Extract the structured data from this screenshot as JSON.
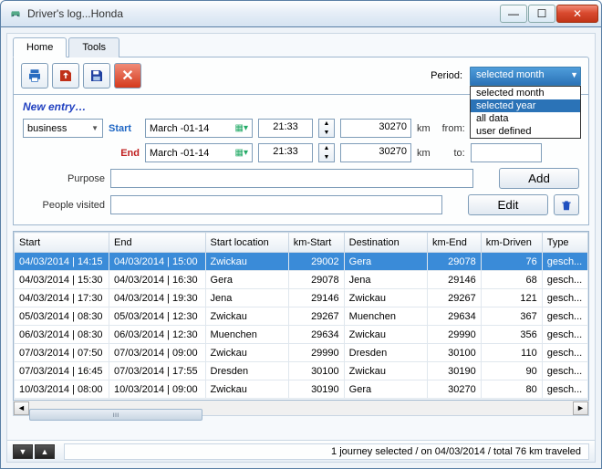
{
  "window": {
    "title": "Driver's log...Honda"
  },
  "tabs": {
    "home": "Home",
    "tools": "Tools"
  },
  "toolbar": {
    "period_label": "Period:",
    "period_selected": "selected month",
    "period_options": [
      "selected month",
      "selected year",
      "all data",
      "user defined"
    ],
    "period_highlight_index": 1
  },
  "newentry": {
    "heading": "New entry…",
    "type_value": "business",
    "start_label": "Start",
    "end_label": "End",
    "start_date": "March  -01-14",
    "end_date": "March  -01-14",
    "start_time": "21:33",
    "end_time": "21:33",
    "start_km": "30270",
    "end_km": "30270",
    "km_unit": "km",
    "from_label": "from:",
    "to_label": "to:",
    "purpose_label": "Purpose",
    "people_label": "People visited",
    "add_btn": "Add",
    "edit_btn": "Edit"
  },
  "grid": {
    "headers": [
      "Start",
      "End",
      "Start location",
      "km-Start",
      "Destination",
      "km-End",
      "km-Driven",
      "Type"
    ],
    "rows": [
      {
        "start": "04/03/2014 | 14:15",
        "end": "04/03/2014 | 15:00",
        "sloc": "Zwickau",
        "skm": "29002",
        "dest": "Gera",
        "ekm": "29078",
        "drv": "76",
        "type": "gesch..."
      },
      {
        "start": "04/03/2014 | 15:30",
        "end": "04/03/2014 | 16:30",
        "sloc": "Gera",
        "skm": "29078",
        "dest": "Jena",
        "ekm": "29146",
        "drv": "68",
        "type": "gesch..."
      },
      {
        "start": "04/03/2014 | 17:30",
        "end": "04/03/2014 | 19:30",
        "sloc": "Jena",
        "skm": "29146",
        "dest": "Zwickau",
        "ekm": "29267",
        "drv": "121",
        "type": "gesch..."
      },
      {
        "start": "05/03/2014 | 08:30",
        "end": "05/03/2014 | 12:30",
        "sloc": "Zwickau",
        "skm": "29267",
        "dest": "Muenchen",
        "ekm": "29634",
        "drv": "367",
        "type": "gesch..."
      },
      {
        "start": "06/03/2014 | 08:30",
        "end": "06/03/2014 | 12:30",
        "sloc": "Muenchen",
        "skm": "29634",
        "dest": "Zwickau",
        "ekm": "29990",
        "drv": "356",
        "type": "gesch..."
      },
      {
        "start": "07/03/2014 | 07:50",
        "end": "07/03/2014 | 09:00",
        "sloc": "Zwickau",
        "skm": "29990",
        "dest": "Dresden",
        "ekm": "30100",
        "drv": "110",
        "type": "gesch..."
      },
      {
        "start": "07/03/2014 | 16:45",
        "end": "07/03/2014 | 17:55",
        "sloc": "Dresden",
        "skm": "30100",
        "dest": "Zwickau",
        "ekm": "30190",
        "drv": "90",
        "type": "gesch..."
      },
      {
        "start": "10/03/2014 | 08:00",
        "end": "10/03/2014 | 09:00",
        "sloc": "Zwickau",
        "skm": "30190",
        "dest": "Gera",
        "ekm": "30270",
        "drv": "80",
        "type": "gesch..."
      }
    ],
    "selected_index": 0
  },
  "status": {
    "text": "1 journey selected / on 04/03/2014 / total 76 km traveled"
  }
}
